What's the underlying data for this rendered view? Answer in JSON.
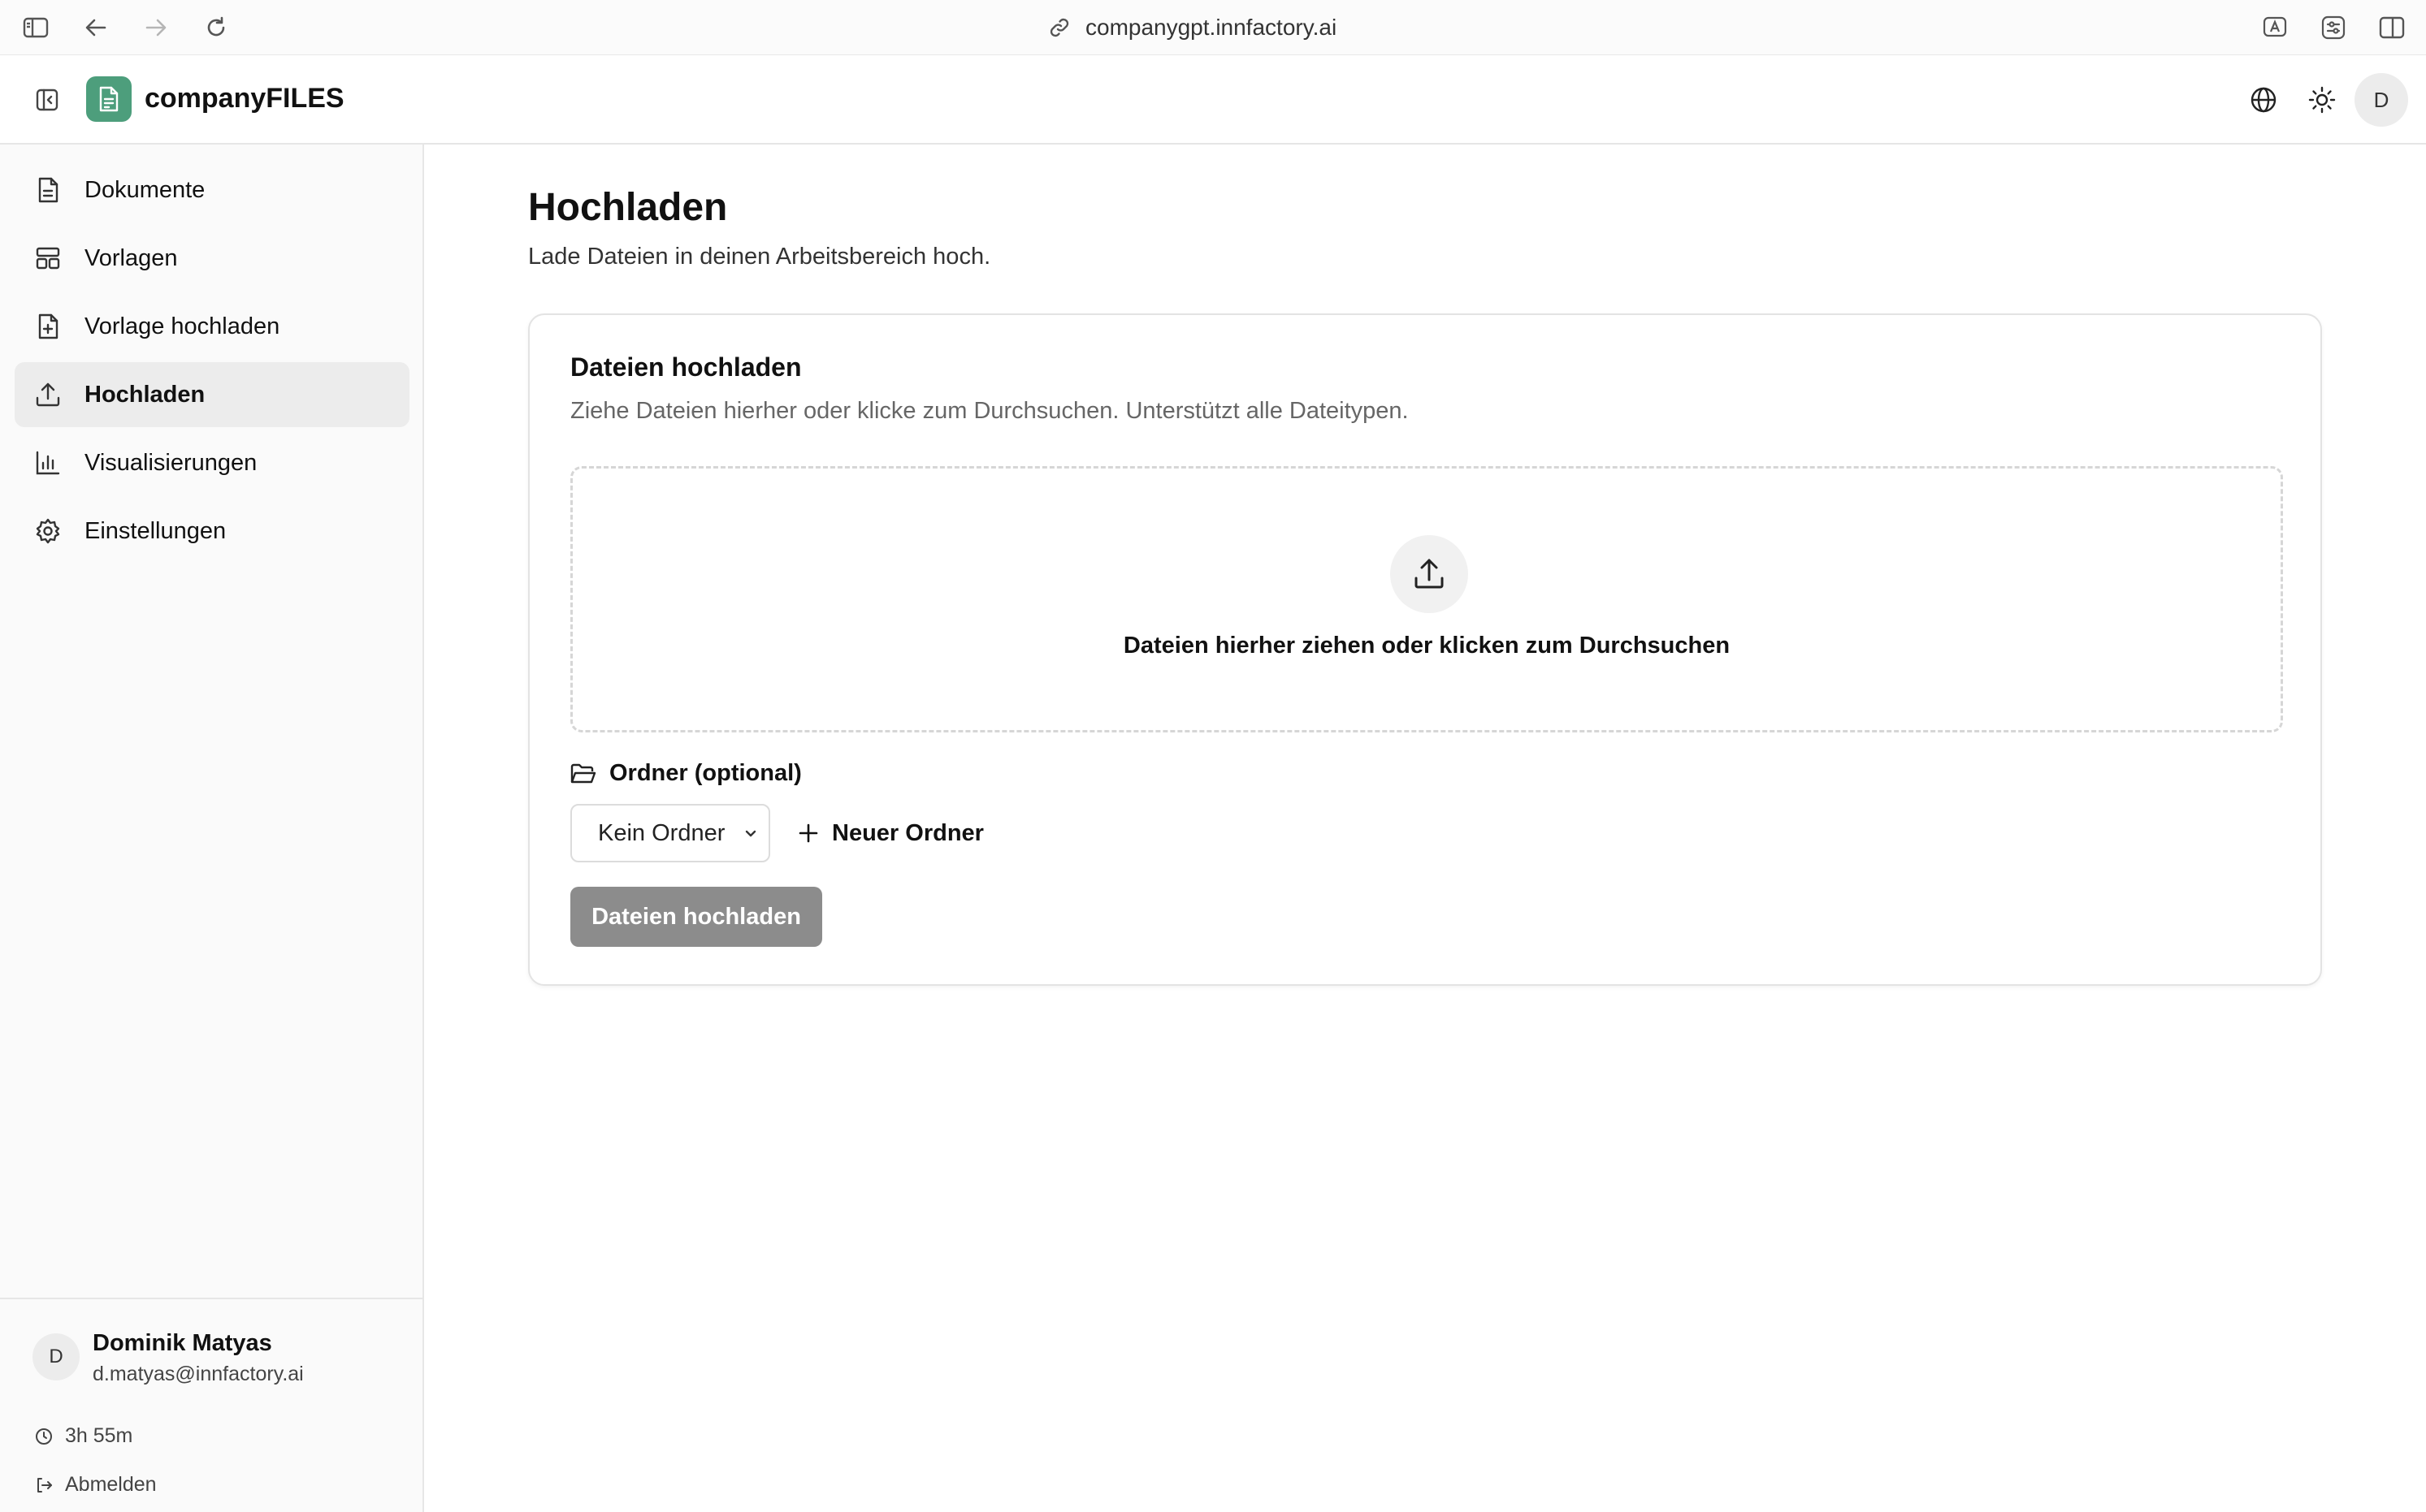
{
  "browser": {
    "url": "companygpt.innfactory.ai"
  },
  "header": {
    "app_title": "companyFILES",
    "avatar_initial": "D"
  },
  "sidebar": {
    "items": [
      {
        "label": "Dokumente",
        "icon": "document-icon",
        "active": false
      },
      {
        "label": "Vorlagen",
        "icon": "template-icon",
        "active": false
      },
      {
        "label": "Vorlage hochladen",
        "icon": "file-plus-icon",
        "active": false
      },
      {
        "label": "Hochladen",
        "icon": "upload-icon",
        "active": true
      },
      {
        "label": "Visualisierungen",
        "icon": "bar-chart-icon",
        "active": false
      },
      {
        "label": "Einstellungen",
        "icon": "gear-icon",
        "active": false
      }
    ],
    "user": {
      "initial": "D",
      "name": "Dominik Matyas",
      "email": "d.matyas@innfactory.ai"
    },
    "session_time": "3h 55m",
    "logout_label": "Abmelden"
  },
  "main": {
    "title": "Hochladen",
    "subtitle": "Lade Dateien in deinen Arbeitsbereich hoch.",
    "card": {
      "title": "Dateien hochladen",
      "description": "Ziehe Dateien hierher oder klicke zum Durchsuchen. Unterstützt alle Dateitypen.",
      "dropzone_text": "Dateien hierher ziehen oder klicken zum Durchsuchen",
      "folder_label": "Ordner (optional)",
      "folder_select_value": "Kein Ordner",
      "new_folder_label": "Neuer Ordner",
      "upload_button_label": "Dateien hochladen"
    }
  },
  "colors": {
    "logo_bg": "#4d9e7c",
    "active_nav_bg": "#ececec",
    "disabled_button_bg": "#8c8c8c"
  }
}
